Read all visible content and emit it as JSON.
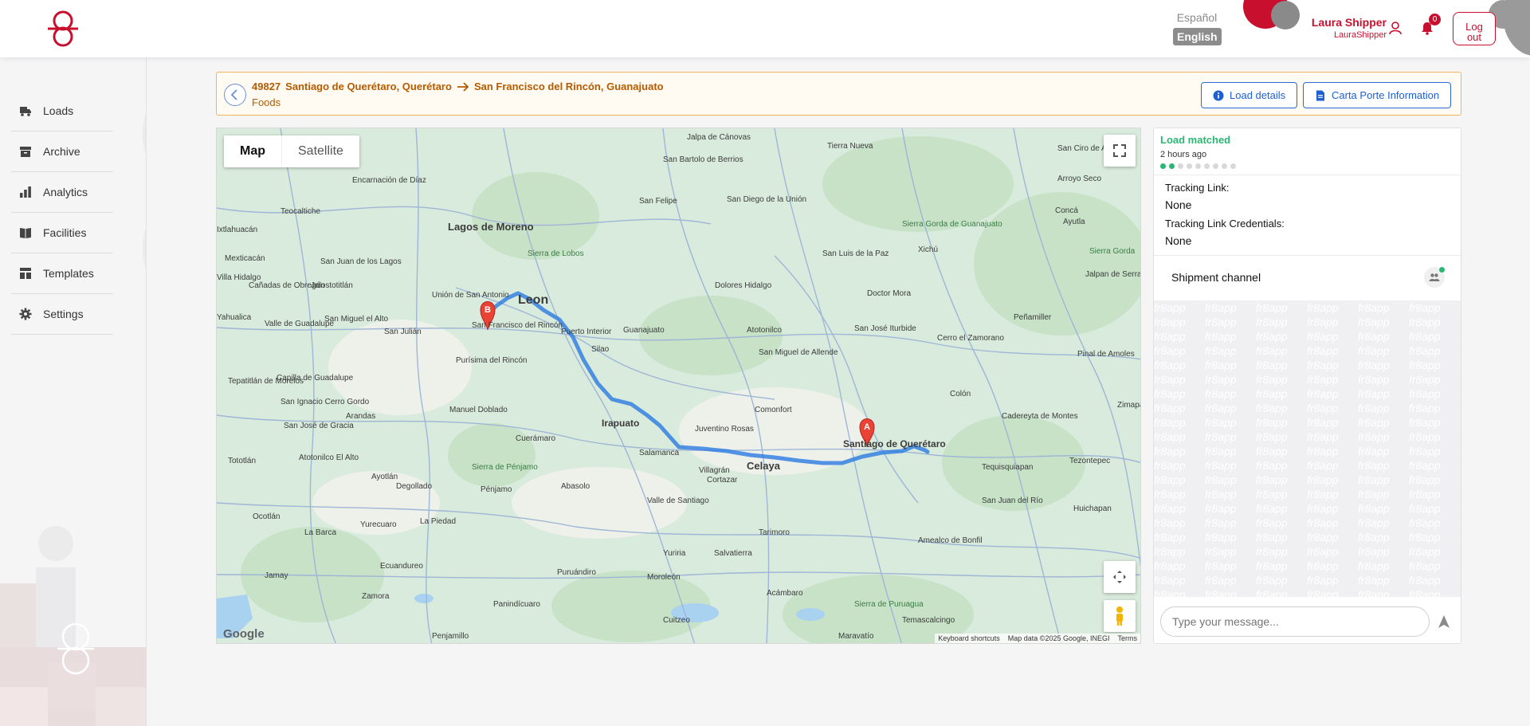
{
  "header": {
    "lang_es": "Español",
    "lang_en": "English",
    "user_name": "Laura Shipper",
    "user_handle": "LauraShipper",
    "notification_count": "0",
    "logout_line1": "Log",
    "logout_line2": "out"
  },
  "sidebar": {
    "items": [
      {
        "label": "Loads",
        "icon": "truck-icon"
      },
      {
        "label": "Archive",
        "icon": "archive-icon"
      },
      {
        "label": "Analytics",
        "icon": "bar-chart-icon"
      },
      {
        "label": "Facilities",
        "icon": "book-icon"
      },
      {
        "label": "Templates",
        "icon": "template-icon"
      },
      {
        "label": "Settings",
        "icon": "gear-icon"
      }
    ]
  },
  "load": {
    "id": "49827",
    "origin": "Santiago de Querétaro, Querétaro",
    "destination": "San Francisco del Rincón, Guanajuato",
    "cargo": "Foods",
    "details_button": "Load details",
    "carta_button": "Carta Porte Information"
  },
  "map": {
    "toggle_map": "Map",
    "toggle_satellite": "Satellite",
    "google": "Google",
    "attribution": [
      "Keyboard shortcuts",
      "Map data ©2025 Google, INEGI",
      "Terms"
    ],
    "marker_a": "A",
    "marker_b": "B",
    "labels": [
      "Jalpa de Cánovas",
      "Tierra Nueva",
      "San Ciro de Acosta",
      "Encarnación de Díaz",
      "San Bartolo de Berrios",
      "San Felipe",
      "San Diego de la Unión",
      "Arroyo Seco",
      "Teocaltiche",
      "Lagos de Moreno",
      "Sierra de Lobos",
      "Sierra Gorda de Guanajuato",
      "Concá",
      "Ayutla",
      "Ixtlahuacán",
      "Villa Hidalgo",
      "San Juan de los Lagos",
      "San Luis de la Paz",
      "Xichú",
      "Sierra Gorda",
      "Mexticacán",
      "Cañadas de Obregón",
      "Jalostotitlán",
      "Dolores Hidalgo",
      "Doctor Mora",
      "Jalpan de Serra",
      "Yahualica",
      "Valle de Guadalupe",
      "San Miguel el Alto",
      "Unión de San Antonio",
      "Leon",
      "Puerto Interior",
      "Guanajuato",
      "Peñamiller",
      "San Julián",
      "San Francisco del Rincón",
      "Silao",
      "Atotonilco",
      "San José Iturbide",
      "Cerro el Zamorano",
      "Purísima del Rincón",
      "San Miguel de Allende",
      "Pinal de Amoles",
      "Tepatitlán de Morelos",
      "Capilla de Guadalupe",
      "San Ignacio Cerro Gordo",
      "San José de Gracia",
      "Manuel Doblado",
      "Comonfort",
      "Colón",
      "Cadereyta de Montes",
      "Arandas",
      "Irapuato",
      "Juventino Rosas",
      "Santiago de Querétaro",
      "Zimapán",
      "Cuerámaro",
      "Salamanca",
      "Celaya",
      "Tequisquiapan",
      "Sierra de Pénjamo",
      "Tototlán",
      "Atotonilco El Alto",
      "Villagrán",
      "Cortazar",
      "Tezontepec",
      "Ayotlán",
      "Degollado",
      "Pénjamo",
      "Abasolo",
      "Valle de Santiago",
      "San Juan del Río",
      "Huichapan",
      "Yurecuaro",
      "La Piedad",
      "Ocotlán",
      "La Barca",
      "Tarimoro",
      "Amealco de Bonfil",
      "Yuriria",
      "Salvatierra",
      "Ecuandureo",
      "Puruándiro",
      "Moroleón",
      "Jamay",
      "Zamora",
      "Panindícuaro",
      "Acámbaro",
      "Cuitzeo",
      "Sierra de Puruagua",
      "Temascalcingo",
      "Maravatío",
      "Penjamillo"
    ]
  },
  "panel": {
    "status": "Load matched",
    "status_time": "2 hours ago",
    "progress_steps_total": 9,
    "progress_steps_done": 2,
    "tracking_link_label": "Tracking Link:",
    "tracking_link_value": "None",
    "tracking_cred_label": "Tracking Link Credentials:",
    "tracking_cred_value": "None",
    "channel": "Shipment channel",
    "message_placeholder": "Type your message...",
    "watermark": "fr8app"
  },
  "brand": {
    "red": "#c8102e",
    "orange": "#b55b00",
    "blue": "#1f5fd1",
    "green": "#2bb673"
  }
}
